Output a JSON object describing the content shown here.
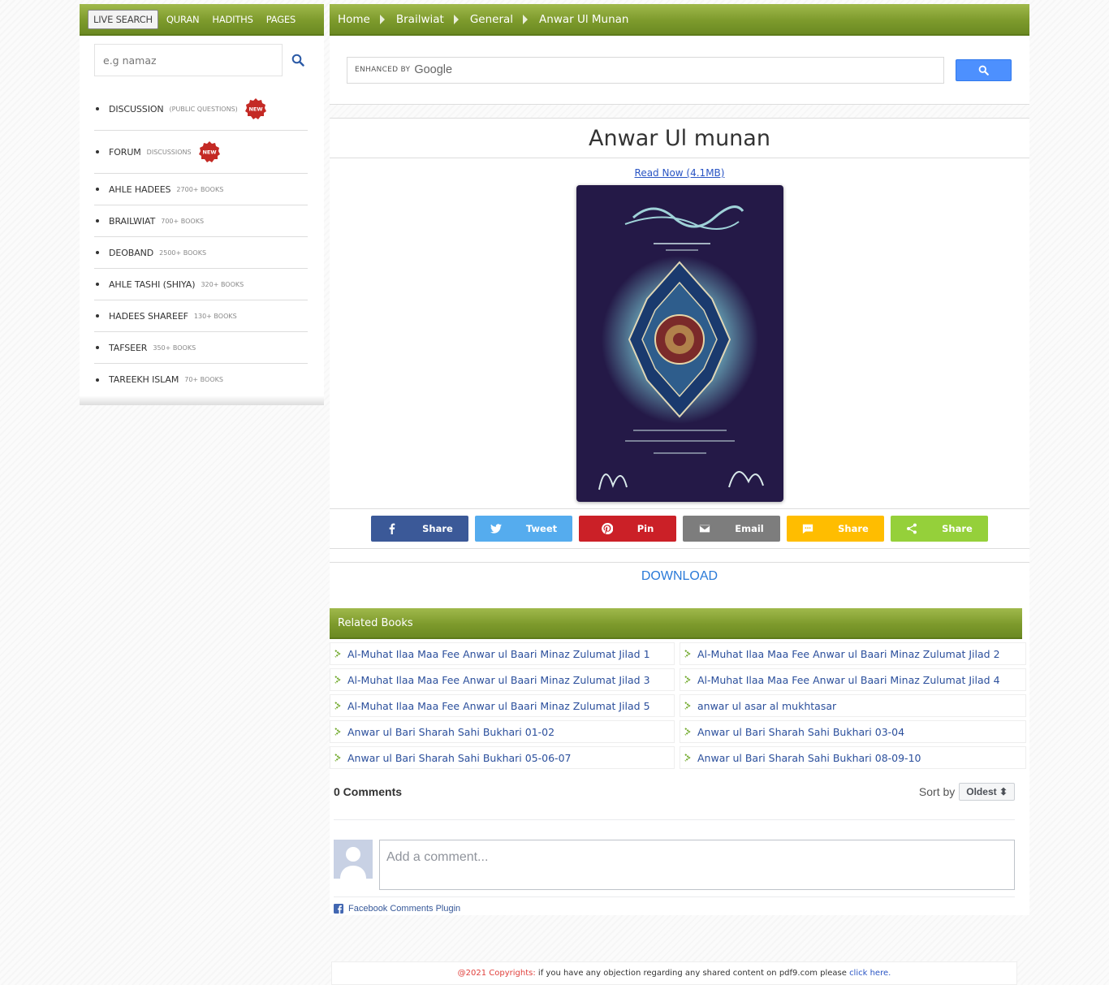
{
  "sidebar": {
    "tabs": [
      "LIVE SEARCH",
      "QURAN",
      "HADITHS",
      "PAGES"
    ],
    "search_placeholder": "e.g namaz",
    "categories": [
      {
        "name": "DISCUSSION",
        "sub": "(PUBLIC QUESTIONS)",
        "is_new": true
      },
      {
        "name": "FORUM",
        "sub": "DISCUSSIONS",
        "is_new": true
      },
      {
        "name": "AHLE HADEES",
        "sub": "2700+ BOOKS"
      },
      {
        "name": "BRAILWIAT",
        "sub": "700+ BOOKS"
      },
      {
        "name": "DEOBAND",
        "sub": "2500+ BOOKS"
      },
      {
        "name": "AHLE TASHI (SHIYA)",
        "sub": "320+ BOOKS"
      },
      {
        "name": "HADEES SHAREEF",
        "sub": "130+ BOOKS"
      },
      {
        "name": "TAFSEER",
        "sub": "350+ BOOKS"
      },
      {
        "name": "TAREEKH ISLAM",
        "sub": "70+ BOOKS"
      }
    ],
    "new_badge": "NEW"
  },
  "breadcrumb": [
    "Home",
    "Brailwiat",
    "General",
    "Anwar Ul Munan"
  ],
  "gsearch": {
    "enhanced_by": "ENHANCED BY",
    "brand": "Google"
  },
  "book": {
    "title": "Anwar Ul munan",
    "read_now": "Read Now (4.1MB)",
    "download": "DOWNLOAD"
  },
  "share_buttons": [
    {
      "label": "Share",
      "icon": "facebook-icon",
      "color": "#3b5998"
    },
    {
      "label": "Tweet",
      "icon": "twitter-icon",
      "color": "#55acee"
    },
    {
      "label": "Pin",
      "icon": "pinterest-icon",
      "color": "#cb2027"
    },
    {
      "label": "Email",
      "icon": "email-icon",
      "color": "#7d7d7d"
    },
    {
      "label": "Share",
      "icon": "sms-icon",
      "color": "#ffbd00"
    },
    {
      "label": "Share",
      "icon": "share-icon",
      "color": "#95d03a"
    }
  ],
  "related": {
    "heading": "Related Books",
    "items": [
      "Al-Muhat Ilaa Maa Fee Anwar ul Baari Minaz Zulumat Jilad 1",
      "Al-Muhat Ilaa Maa Fee Anwar ul Baari Minaz Zulumat Jilad 2",
      "Al-Muhat Ilaa Maa Fee Anwar ul Baari Minaz Zulumat Jilad 3",
      "Al-Muhat Ilaa Maa Fee Anwar ul Baari Minaz Zulumat Jilad 4",
      "Al-Muhat Ilaa Maa Fee Anwar ul Baari Minaz Zulumat Jilad 5",
      "anwar ul asar al mukhtasar",
      "Anwar ul Bari Sharah Sahi Bukhari 01-02",
      "Anwar ul Bari Sharah Sahi Bukhari 03-04",
      "Anwar ul Bari Sharah Sahi Bukhari 05-06-07",
      "Anwar ul Bari Sharah Sahi Bukhari 08-09-10"
    ]
  },
  "comments": {
    "count": "0 Comments",
    "sort_label": "Sort by",
    "sort_value": "Oldest",
    "placeholder": "Add a comment...",
    "plugin": "Facebook Comments Plugin"
  },
  "footer": {
    "copyright": "@2021 Copyrights:",
    "text": " if you have any objection regarding any shared content on pdf9.com please ",
    "link": "click here."
  },
  "colors": {
    "olive": "#7d9a2c",
    "link": "#2a55c4"
  }
}
